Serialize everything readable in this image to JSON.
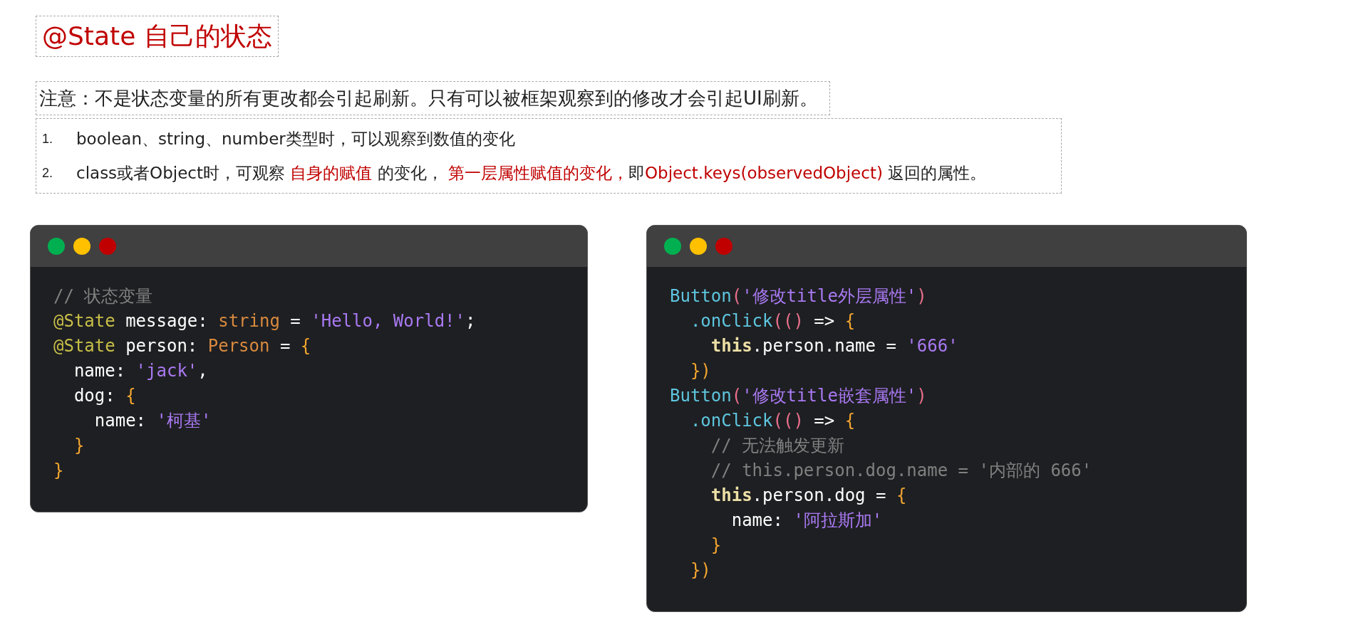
{
  "title": "@State 自己的状态",
  "notice": "注意：不是状态变量的所有更改都会引起刷新。只有可以被框架观察到的修改才会引起UI刷新。",
  "list": [
    {
      "number": "1.",
      "segments": [
        {
          "text": "boolean、string、number类型时，可以观察到数值的变化",
          "highlight": false
        }
      ]
    },
    {
      "number": "2.",
      "segments": [
        {
          "text": "class或者Object时，可观察 ",
          "highlight": false
        },
        {
          "text": "自身的赋值",
          "highlight": true
        },
        {
          "text": " 的变化， ",
          "highlight": false
        },
        {
          "text": "第一层属性赋值的变化，",
          "highlight": true
        },
        {
          "text": "即",
          "highlight": false
        },
        {
          "text": "Object.keys(observedObject)",
          "highlight": true
        },
        {
          "text": " 返回的属性。",
          "highlight": false
        }
      ]
    }
  ],
  "code_windows": [
    {
      "lines": [
        [
          {
            "kind": "comment",
            "text": "// 状态变量"
          }
        ],
        [
          {
            "kind": "decorator",
            "text": "@State"
          },
          {
            "kind": "plain",
            "text": " message: "
          },
          {
            "kind": "type",
            "text": "string"
          },
          {
            "kind": "plain",
            "text": " = "
          },
          {
            "kind": "string",
            "text": "'Hello, World!'"
          },
          {
            "kind": "plain",
            "text": ";"
          }
        ],
        [
          {
            "kind": "decorator",
            "text": "@State"
          },
          {
            "kind": "plain",
            "text": " person: "
          },
          {
            "kind": "type",
            "text": "Person"
          },
          {
            "kind": "plain",
            "text": " = "
          },
          {
            "kind": "brace",
            "text": "{"
          }
        ],
        [
          {
            "kind": "plain",
            "text": "  name: "
          },
          {
            "kind": "string",
            "text": "'jack'"
          },
          {
            "kind": "plain",
            "text": ","
          }
        ],
        [
          {
            "kind": "plain",
            "text": "  dog: "
          },
          {
            "kind": "brace",
            "text": "{"
          }
        ],
        [
          {
            "kind": "plain",
            "text": "    name: "
          },
          {
            "kind": "string",
            "text": "'柯基'"
          }
        ],
        [
          {
            "kind": "brace",
            "text": "  }"
          }
        ],
        [
          {
            "kind": "brace",
            "text": "}"
          }
        ]
      ]
    },
    {
      "lines": [
        [
          {
            "kind": "func",
            "text": "Button"
          },
          {
            "kind": "paren",
            "text": "("
          },
          {
            "kind": "string",
            "text": "'修改title外层属性'"
          },
          {
            "kind": "paren",
            "text": ")"
          }
        ],
        [
          {
            "kind": "func",
            "text": "  .onClick"
          },
          {
            "kind": "paren",
            "text": "(()"
          },
          {
            "kind": "plain",
            "text": " => "
          },
          {
            "kind": "brace",
            "text": "{"
          }
        ],
        [
          {
            "kind": "keyword",
            "text": "    this"
          },
          {
            "kind": "plain",
            "text": ".person.name = "
          },
          {
            "kind": "string",
            "text": "'666'"
          }
        ],
        [
          {
            "kind": "brace",
            "text": "  })"
          }
        ],
        [
          {
            "kind": "func",
            "text": "Button"
          },
          {
            "kind": "paren",
            "text": "("
          },
          {
            "kind": "string",
            "text": "'修改title嵌套属性'"
          },
          {
            "kind": "paren",
            "text": ")"
          }
        ],
        [
          {
            "kind": "func",
            "text": "  .onClick"
          },
          {
            "kind": "paren",
            "text": "(()"
          },
          {
            "kind": "plain",
            "text": " => "
          },
          {
            "kind": "brace",
            "text": "{"
          }
        ],
        [
          {
            "kind": "comment",
            "text": "    // 无法触发更新"
          }
        ],
        [
          {
            "kind": "comment",
            "text": "    // this.person.dog.name = '内部的 666'"
          }
        ],
        [
          {
            "kind": "keyword",
            "text": "    this"
          },
          {
            "kind": "plain",
            "text": ".person.dog = "
          },
          {
            "kind": "brace",
            "text": "{"
          }
        ],
        [
          {
            "kind": "plain",
            "text": "      name: "
          },
          {
            "kind": "string",
            "text": "'阿拉斯加'"
          }
        ],
        [
          {
            "kind": "brace",
            "text": "    }"
          }
        ],
        [
          {
            "kind": "brace",
            "text": "  })"
          }
        ]
      ]
    }
  ]
}
